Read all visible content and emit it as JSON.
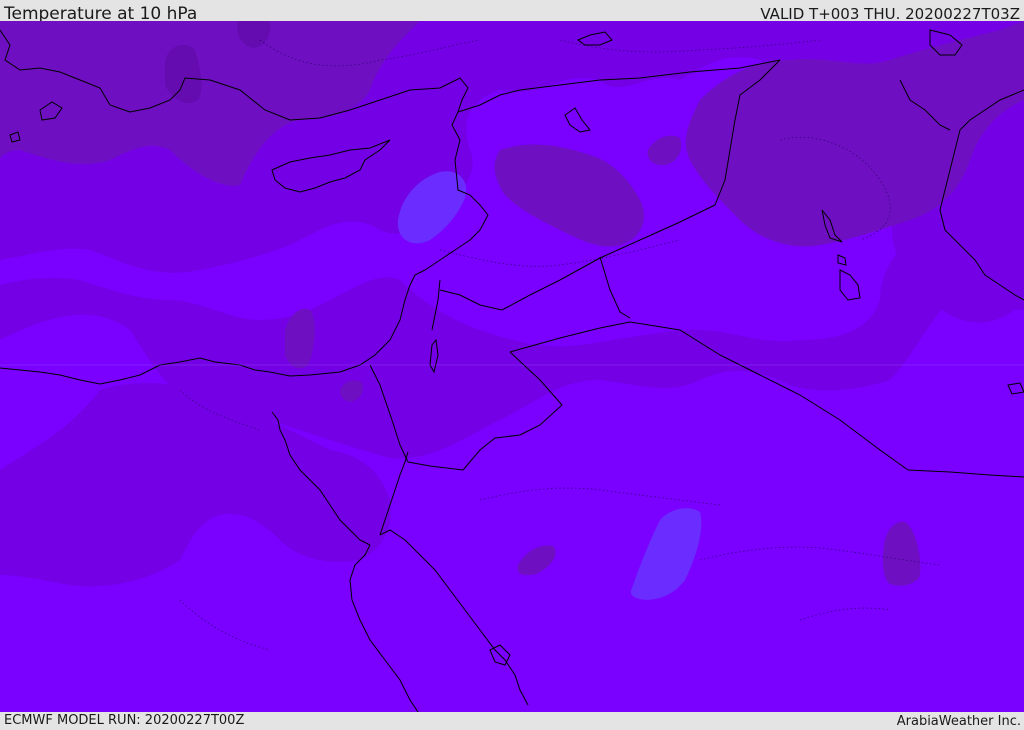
{
  "header": {
    "title": "Temperature at 10 hPa",
    "valid": "VALID T+003 THU. 20200227T03Z"
  },
  "footer": {
    "model_run": "ECMWF MODEL RUN: 20200227T00Z",
    "credit": "ArabiaWeather Inc."
  },
  "colors": {
    "field_cold": "#7a00ff",
    "field_mid": "#7400e6",
    "field_warm": "#6e10c2",
    "field_warmest": "#650cb0",
    "field_coldest": "#6a2cff",
    "coastline": "#000000",
    "border": "#000000"
  }
}
